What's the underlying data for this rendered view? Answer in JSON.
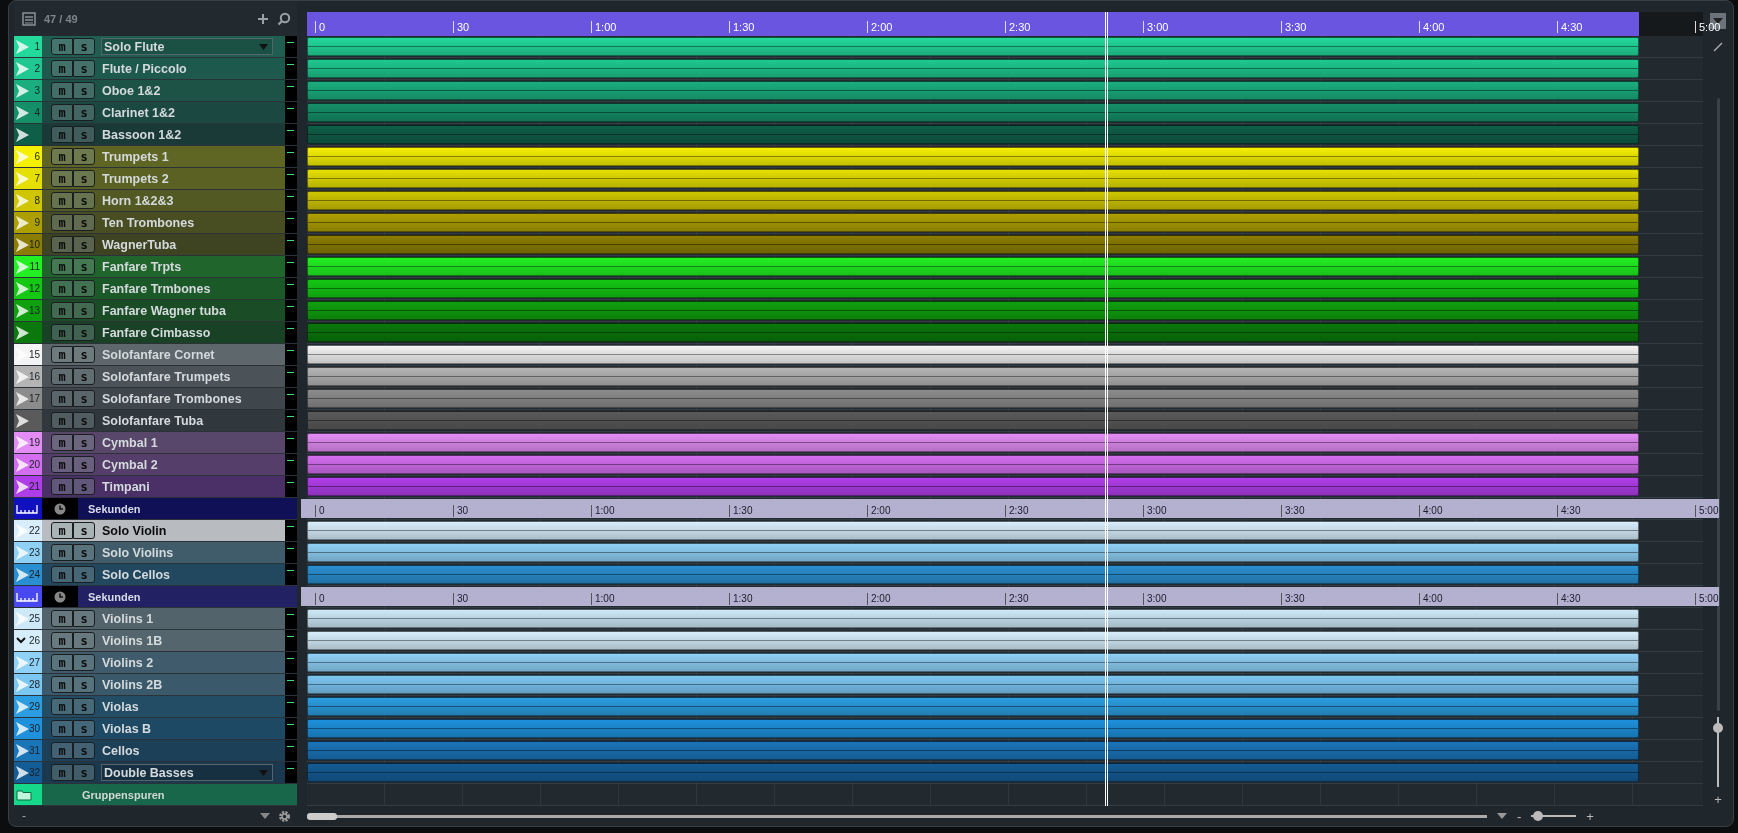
{
  "track_list": {
    "count": "47 / 49",
    "footer_text": "-"
  },
  "timeline": {
    "labels": [
      "0",
      "30",
      "1:00",
      "1:30",
      "2:00",
      "2:30",
      "3:00",
      "3:30",
      "4:00",
      "4:30",
      "5:00"
    ]
  },
  "tracks": [
    {
      "kind": "audio",
      "number": "1",
      "name": "Solo Flute",
      "color": "#23d99b",
      "selected": false,
      "expanded": false,
      "name_field": true,
      "mute": "m",
      "solo": "s"
    },
    {
      "kind": "audio",
      "number": "2",
      "name": "Flute / Piccolo",
      "color": "#1fc890",
      "selected": false,
      "expanded": false,
      "name_field": false,
      "mute": "m",
      "solo": "s"
    },
    {
      "kind": "audio",
      "number": "3",
      "name": "Oboe 1&2",
      "color": "#1aae7e",
      "selected": false,
      "expanded": false,
      "name_field": false,
      "mute": "m",
      "solo": "s"
    },
    {
      "kind": "audio",
      "number": "4",
      "name": "Clarinet 1&2",
      "color": "#158f68",
      "selected": false,
      "expanded": false,
      "name_field": false,
      "mute": "m",
      "solo": "s"
    },
    {
      "kind": "audio",
      "name": "Bassoon 1&2",
      "color": "#0f5e48",
      "selected": false,
      "expanded": false,
      "name_field": false,
      "mute": "m",
      "solo": "s"
    },
    {
      "kind": "audio",
      "number": "6",
      "name": "Trumpets 1",
      "color": "#f5f000",
      "selected": false,
      "expanded": false,
      "name_field": false,
      "mute": "m",
      "solo": "s"
    },
    {
      "kind": "audio",
      "number": "7",
      "name": "Trumpets 2",
      "color": "#e6e000",
      "selected": false,
      "expanded": false,
      "name_field": false,
      "mute": "m",
      "solo": "s"
    },
    {
      "kind": "audio",
      "number": "8",
      "name": "Horn 1&2&3",
      "color": "#cfc600",
      "selected": false,
      "expanded": false,
      "name_field": false,
      "mute": "m",
      "solo": "s"
    },
    {
      "kind": "audio",
      "number": "9",
      "name": "Ten Trombones",
      "color": "#ad9f00",
      "selected": false,
      "expanded": false,
      "name_field": false,
      "mute": "m",
      "solo": "s"
    },
    {
      "kind": "audio",
      "number": "10",
      "name": "WagnerTuba",
      "color": "#8a7d00",
      "selected": false,
      "expanded": false,
      "name_field": false,
      "mute": "m",
      "solo": "s"
    },
    {
      "kind": "audio",
      "number": "11",
      "name": "Fanfare Trpts",
      "color": "#22f022",
      "selected": false,
      "expanded": false,
      "name_field": false,
      "mute": "m",
      "solo": "s"
    },
    {
      "kind": "audio",
      "number": "12",
      "name": "Fanfare Trmbones",
      "color": "#14c814",
      "selected": false,
      "expanded": false,
      "name_field": false,
      "mute": "m",
      "solo": "s"
    },
    {
      "kind": "audio",
      "number": "13",
      "name": "Fanfare Wagner tuba",
      "color": "#0fa00f",
      "selected": false,
      "expanded": false,
      "name_field": false,
      "mute": "m",
      "solo": "s"
    },
    {
      "kind": "audio",
      "name": "Fanfare  Cimbasso",
      "color": "#0a780a",
      "selected": false,
      "expanded": false,
      "name_field": false,
      "mute": "m",
      "solo": "s"
    },
    {
      "kind": "audio",
      "number": "15",
      "name": "Solofanfare Cornet",
      "color": "#f4f4f4",
      "selected": false,
      "expanded": false,
      "name_field": false,
      "mute": "m",
      "solo": "s"
    },
    {
      "kind": "audio",
      "number": "16",
      "name": "Solofanfare Trumpets",
      "color": "#b4b4b4",
      "selected": false,
      "expanded": false,
      "name_field": false,
      "mute": "m",
      "solo": "s"
    },
    {
      "kind": "audio",
      "number": "17",
      "name": "Solofanfare Trombones",
      "color": "#8c8c8c",
      "selected": false,
      "expanded": false,
      "name_field": false,
      "mute": "m",
      "solo": "s"
    },
    {
      "kind": "audio",
      "name": "Solofanfare Tuba",
      "color": "#5a5a5a",
      "selected": false,
      "expanded": false,
      "name_field": false,
      "mute": "m",
      "solo": "s"
    },
    {
      "kind": "audio",
      "number": "19",
      "name": "Cymbal 1",
      "color": "#e38cf5",
      "selected": false,
      "expanded": false,
      "name_field": false,
      "mute": "m",
      "solo": "s"
    },
    {
      "kind": "audio",
      "number": "20",
      "name": "Cymbal 2",
      "color": "#d46ef0",
      "selected": false,
      "expanded": false,
      "name_field": false,
      "mute": "m",
      "solo": "s"
    },
    {
      "kind": "audio",
      "number": "21",
      "name": "Timpani",
      "color": "#b03ee8",
      "selected": false,
      "expanded": false,
      "name_field": false,
      "mute": "m",
      "solo": "s"
    },
    {
      "kind": "ruler",
      "name": "Sekunden",
      "color": "#1010c0",
      "labels": [
        "0",
        "30",
        "1:00",
        "1:30",
        "2:00",
        "2:30",
        "3:00",
        "3:30",
        "4:00",
        "4:30",
        "5:00"
      ]
    },
    {
      "kind": "audio",
      "number": "22",
      "name": "Solo Violin",
      "color": "#d8eefc",
      "selected": true,
      "expanded": false,
      "name_field": false,
      "mute": "m",
      "solo": "s"
    },
    {
      "kind": "audio",
      "number": "23",
      "name": "Solo Violins",
      "color": "#8fd0f5",
      "selected": false,
      "expanded": false,
      "name_field": false,
      "mute": "m",
      "solo": "s"
    },
    {
      "kind": "audio",
      "number": "24",
      "name": "Solo Cellos",
      "color": "#2a8fd0",
      "selected": false,
      "expanded": false,
      "name_field": false,
      "mute": "m",
      "solo": "s"
    },
    {
      "kind": "ruler",
      "name": "Sekunden",
      "color": "#4848f0",
      "labels": [
        "0",
        "30",
        "1:00",
        "1:30",
        "2:00",
        "2:30",
        "3:00",
        "3:30",
        "4:00",
        "4:30",
        "5:00"
      ]
    },
    {
      "kind": "audio",
      "number": "25",
      "name": "Violins 1",
      "color": "#cde9f8",
      "selected": false,
      "expanded": false,
      "name_field": false,
      "mute": "m",
      "solo": "s"
    },
    {
      "kind": "audio",
      "number": "26",
      "name": "Violins 1B",
      "color": "#d6eefc",
      "selected": false,
      "expanded": true,
      "name_field": false,
      "mute": "m",
      "solo": "s"
    },
    {
      "kind": "audio",
      "number": "27",
      "name": "Violins 2",
      "color": "#8fd1f7",
      "selected": false,
      "expanded": false,
      "name_field": false,
      "mute": "m",
      "solo": "s"
    },
    {
      "kind": "audio",
      "number": "28",
      "name": "Violins 2B",
      "color": "#7cc6f2",
      "selected": false,
      "expanded": false,
      "name_field": false,
      "mute": "m",
      "solo": "s"
    },
    {
      "kind": "audio",
      "number": "29",
      "name": "Violas",
      "color": "#2c9de0",
      "selected": false,
      "expanded": false,
      "name_field": false,
      "mute": "m",
      "solo": "s"
    },
    {
      "kind": "audio",
      "number": "30",
      "name": "Violas B",
      "color": "#1e90dc",
      "selected": false,
      "expanded": false,
      "name_field": false,
      "mute": "m",
      "solo": "s"
    },
    {
      "kind": "audio",
      "number": "31",
      "name": "Cellos",
      "color": "#1a74b8",
      "selected": false,
      "expanded": false,
      "name_field": false,
      "mute": "m",
      "solo": "s"
    },
    {
      "kind": "audio",
      "number": "32",
      "name": "Double Basses",
      "color": "#145c95",
      "selected": false,
      "expanded": false,
      "name_field": true,
      "mute": "m",
      "solo": "s"
    },
    {
      "kind": "folder",
      "name": "Gruppenspuren",
      "color": "#16d88a"
    }
  ],
  "horizontal_zoom": {
    "minus": "-",
    "plus": "+",
    "level": 0.05
  },
  "vertical_zoom": {
    "plus": "+",
    "level": 0.85
  }
}
